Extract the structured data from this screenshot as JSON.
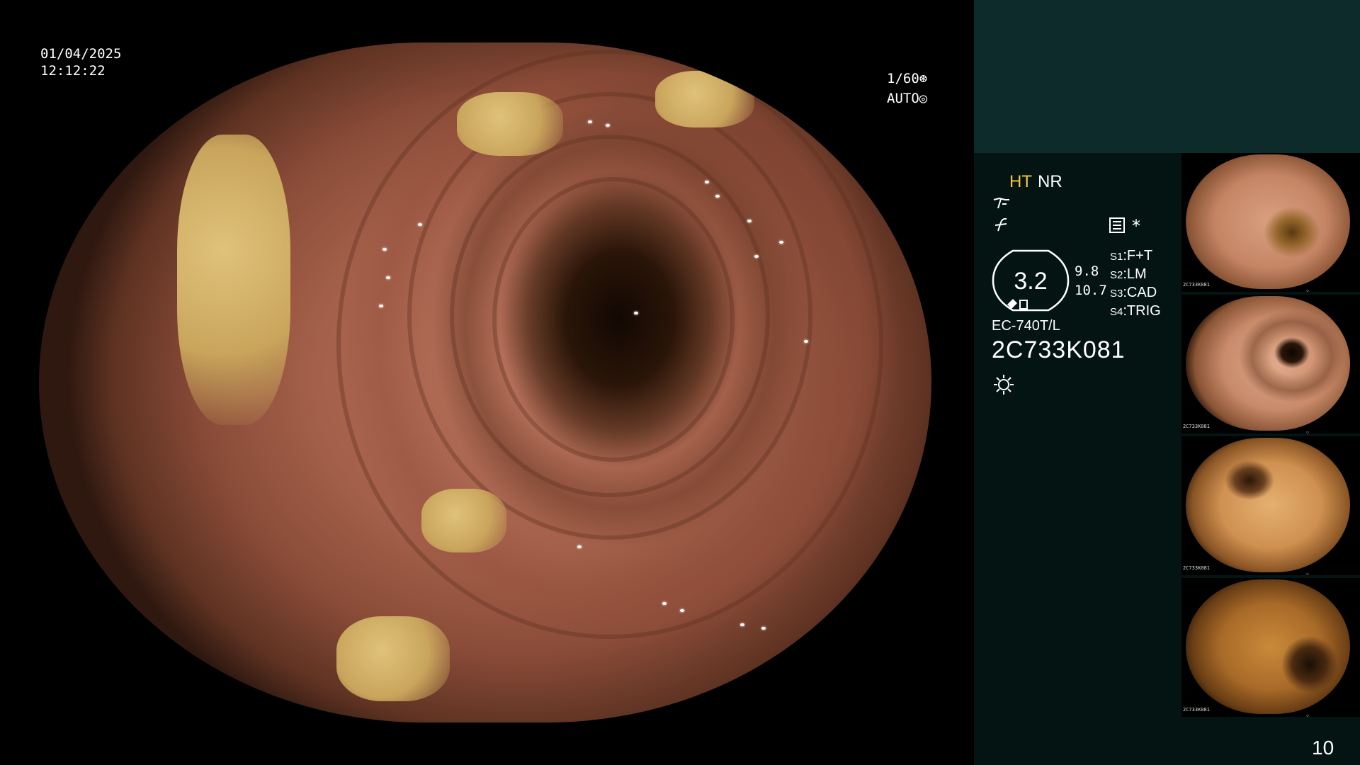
{
  "overlay": {
    "date": "01/04/2025",
    "time": "12:12:22",
    "shutter": "1/60",
    "iris": "AUTO"
  },
  "status": {
    "ht": "HT",
    "nr": "NR",
    "ht_color": "#f5c542"
  },
  "zoom": {
    "value": "3.2",
    "num_top": "9.8",
    "num_bottom": "10.7"
  },
  "switches": [
    {
      "key": "S1",
      "label": "F+T"
    },
    {
      "key": "S2",
      "label": "LM"
    },
    {
      "key": "S3",
      "label": "CAD"
    },
    {
      "key": "S4",
      "label": "TRIG"
    }
  ],
  "scope": {
    "model": "EC-740T/L",
    "serial": "2C733K081"
  },
  "star": "*",
  "thumbnails": [
    {
      "serial": "2C733K081"
    },
    {
      "serial": "2C733K081"
    },
    {
      "serial": "2C733K081"
    },
    {
      "serial": "2C733K081"
    }
  ],
  "page_number": "10",
  "icons": {
    "shutter": "shutter-icon",
    "iris": "iris-icon",
    "structure": "structure-enhance-icon",
    "color": "color-enhance-icon",
    "settings": "settings-list-icon",
    "light": "light-source-icon"
  }
}
